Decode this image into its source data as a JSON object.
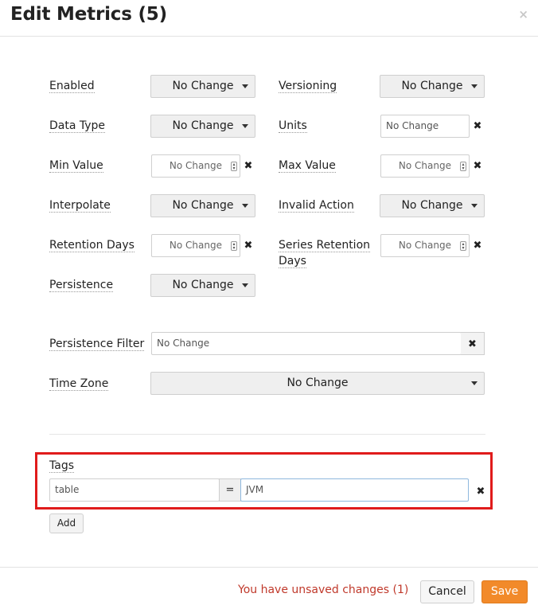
{
  "header": {
    "title": "Edit Metrics (5)",
    "close_glyph": "×"
  },
  "form": {
    "enabled": {
      "label": "Enabled",
      "value": "No Change"
    },
    "versioning": {
      "label": "Versioning",
      "value": "No Change"
    },
    "data_type": {
      "label": "Data Type",
      "value": "No Change"
    },
    "units": {
      "label": "Units",
      "placeholder": "No Change"
    },
    "min_value": {
      "label": "Min Value",
      "placeholder": "No Change"
    },
    "max_value": {
      "label": "Max Value",
      "placeholder": "No Change"
    },
    "interpolate": {
      "label": "Interpolate",
      "value": "No Change"
    },
    "invalid_action": {
      "label": "Invalid Action",
      "value": "No Change"
    },
    "retention_days": {
      "label": "Retention Days",
      "placeholder": "No Change"
    },
    "series_retention_days": {
      "label_line1": "Series Retention",
      "label_line2": "Days",
      "placeholder": "No Change"
    },
    "persistence": {
      "label": "Persistence",
      "value": "No Change"
    },
    "persistence_filter": {
      "label": "Persistence Filter",
      "placeholder": "No Change"
    },
    "time_zone": {
      "label": "Time Zone",
      "value": "No Change"
    },
    "clear_glyph": "✖"
  },
  "tags": {
    "label": "Tags",
    "rows": [
      {
        "key": "table",
        "separator": "=",
        "value": "JVM"
      }
    ],
    "add_label": "Add"
  },
  "footer": {
    "status": "You have unsaved changes (1)",
    "cancel_label": "Cancel",
    "save_label": "Save"
  },
  "colors": {
    "accent": "#f28a2a",
    "warning_text": "#c0392b",
    "highlight_box": "#e01b1b"
  },
  "icons": {
    "dropdown": "caret-down-icon",
    "clear": "times-icon",
    "close": "close-icon"
  }
}
